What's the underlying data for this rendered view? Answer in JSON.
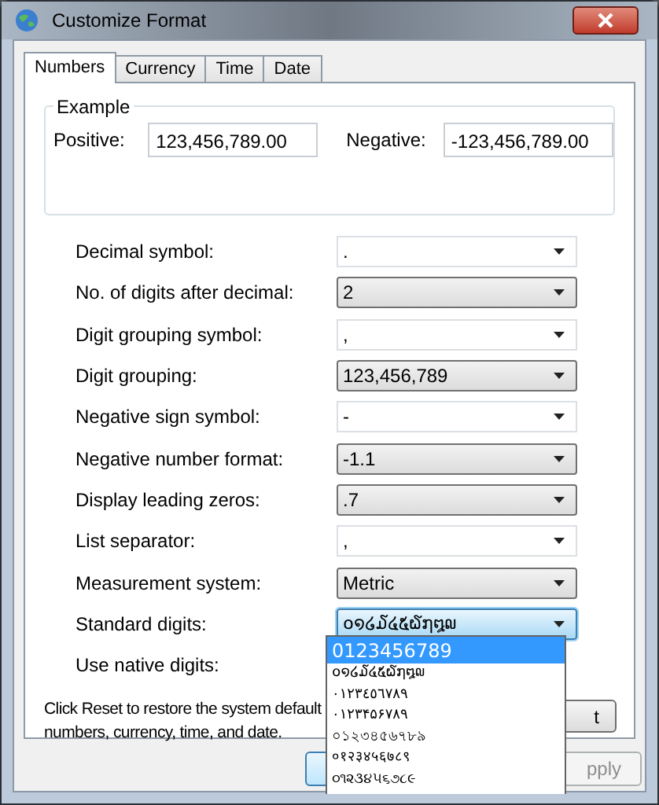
{
  "window": {
    "title": "Customize Format"
  },
  "tabs": [
    {
      "label": "Numbers",
      "selected": true
    },
    {
      "label": "Currency",
      "selected": false
    },
    {
      "label": "Time",
      "selected": false
    },
    {
      "label": "Date",
      "selected": false
    }
  ],
  "example": {
    "title": "Example",
    "positive_label": "Positive:",
    "positive_value": "123,456,789.00",
    "negative_label": "Negative:",
    "negative_value": "-123,456,789.00"
  },
  "settings": [
    {
      "label": "Decimal symbol:",
      "value": ".",
      "kind": "editable",
      "expanded": false
    },
    {
      "label": "No. of digits after decimal:",
      "value": "2",
      "kind": "list",
      "expanded": false
    },
    {
      "label": "Digit grouping symbol:",
      "value": ",",
      "kind": "editable",
      "expanded": false
    },
    {
      "label": "Digit grouping:",
      "value": "123,456,789",
      "kind": "list",
      "expanded": false
    },
    {
      "label": "Negative sign symbol:",
      "value": "-",
      "kind": "editable",
      "expanded": false
    },
    {
      "label": "Negative number format:",
      "value": "-1.1",
      "kind": "list",
      "expanded": false
    },
    {
      "label": "Display leading zeros:",
      "value": ".7",
      "kind": "list",
      "expanded": false
    },
    {
      "label": "List separator:",
      "value": ",",
      "kind": "editable",
      "expanded": false
    },
    {
      "label": "Measurement system:",
      "value": "Metric",
      "kind": "list",
      "expanded": false
    },
    {
      "label": "Standard digits:",
      "value": "໐໑໒໓໔໕໖໗໘໙",
      "kind": "list",
      "expanded": true
    },
    {
      "label": "Use native digits:",
      "kind": "hidden"
    }
  ],
  "dropdown_options": [
    {
      "label": "0123456789",
      "selected": true
    },
    {
      "label": "໐໑໒໓໔໕໖໗໘໙",
      "selected": false
    },
    {
      "label": "٠١٢٣٤٥٦٧٨٩",
      "selected": false
    },
    {
      "label": "۰۱۲۳۴۵۶۷۸۹",
      "selected": false
    },
    {
      "label": "০১২৩৪৫৬৭৮৯",
      "selected": false
    },
    {
      "label": "०१२३४५६७८९",
      "selected": false
    },
    {
      "label": "૦૧૨૩૪૫૬૭૮૯",
      "selected": false
    }
  ],
  "reset_note": "Click Reset to restore the system default numbers, currency, time, and date.",
  "reset_button": {
    "label": "t"
  },
  "buttons": [
    {
      "disabled": false
    },
    {
      "label": "pply",
      "disabled": true
    }
  ]
}
